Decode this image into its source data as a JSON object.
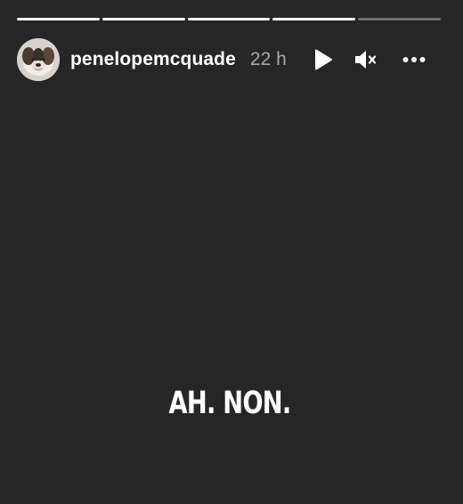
{
  "story": {
    "progress": [
      1,
      1,
      1,
      1,
      0
    ],
    "header": {
      "username": "penelopemcquade",
      "time": "22 h"
    },
    "controls": {
      "play_icon": "play-icon",
      "mute_icon": "speaker-muted-icon",
      "more_icon": "more-horizontal-icon"
    },
    "content_text": "AH. NON."
  },
  "colors": {
    "background": "#262626",
    "text": "#ffffff",
    "muted_text": "#a8a8a8"
  }
}
